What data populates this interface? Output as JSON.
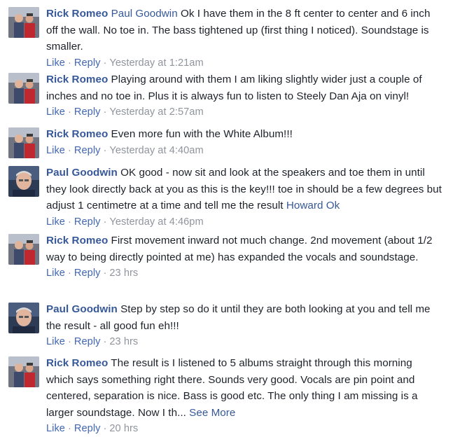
{
  "comments": [
    {
      "author": "Rick Romeo",
      "avatar": "rick-avatar-icon",
      "segments": [
        {
          "type": "mention",
          "text": "Paul Goodwin"
        },
        {
          "type": "text",
          "text": " Ok I have them in the 8 ft center to center and 6 inch off the wall. No toe in. The bass tightened up (first thing I noticed). Soundstage is smaller."
        }
      ],
      "like": "Like",
      "reply": "Reply",
      "time": "Yesterday at 1:21am"
    },
    {
      "author": "Rick Romeo",
      "avatar": "rick-avatar-icon",
      "segments": [
        {
          "type": "text",
          "text": " Playing around with them I am liking slightly wider just a couple of inches and no toe in. Plus it is always fun to listen to Steely Dan Aja on vinyl!"
        }
      ],
      "like": "Like",
      "reply": "Reply",
      "time": "Yesterday at 2:57am"
    },
    {
      "author": "Rick Romeo",
      "avatar": "rick-avatar-icon",
      "segments": [
        {
          "type": "text",
          "text": " Even more fun with the White Album!!!"
        }
      ],
      "like": "Like",
      "reply": "Reply",
      "time": "Yesterday at 4:40am"
    },
    {
      "author": "Paul Goodwin",
      "avatar": "paul-avatar-icon",
      "segments": [
        {
          "type": "text",
          "text": " OK good - now sit and look at the speakers and toe them in until they look directly back at you as this is the key!!! toe in should be a few degrees but adjust 1 centimetre at a time and tell me the result "
        },
        {
          "type": "mention",
          "text": "Howard Ok"
        }
      ],
      "like": "Like",
      "reply": "Reply",
      "time": "Yesterday at 4:46pm"
    },
    {
      "author": "Rick Romeo",
      "avatar": "rick-avatar-icon",
      "segments": [
        {
          "type": "text",
          "text": " First movement inward not much change. 2nd movement (about 1/2 way to being directly pointed at me) has expanded the vocals and soundstage."
        }
      ],
      "like": "Like",
      "reply": "Reply",
      "time": "23 hrs"
    },
    {
      "author": "Paul Goodwin",
      "avatar": "paul-avatar-icon",
      "segments": [
        {
          "type": "text",
          "text": " Step by step so do it until they are both looking at you and tell me the result - all good fun eh!!!"
        }
      ],
      "like": "Like",
      "reply": "Reply",
      "time": "23 hrs"
    },
    {
      "author": "Rick Romeo",
      "avatar": "rick-avatar-icon",
      "segments": [
        {
          "type": "text",
          "text": " The result is I listened to 5 albums straight through this morning which says something right there. Sounds very good. Vocals are pin point and centered, separation is nice. Bass is good etc. The only thing I am missing is a larger soundstage. Now I th... "
        },
        {
          "type": "seemore",
          "text": "See More"
        }
      ],
      "like": "Like",
      "reply": "Reply",
      "time": "20 hrs"
    }
  ],
  "separator": "·",
  "colors": {
    "link": "#365899",
    "action_link": "#4267b2",
    "meta": "#90949c",
    "text": "#1d2129"
  }
}
